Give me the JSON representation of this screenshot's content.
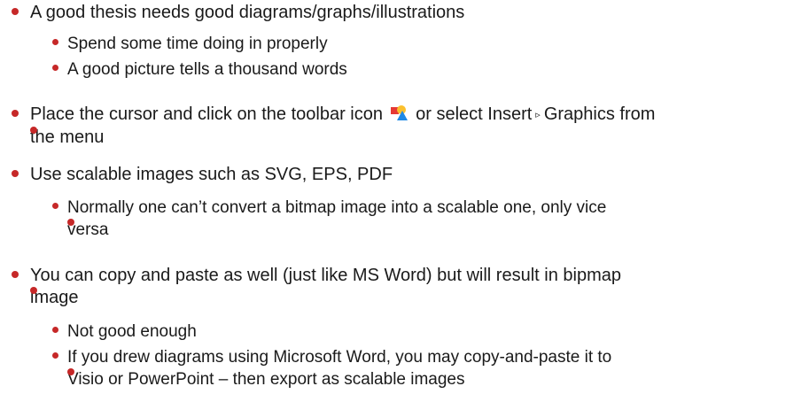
{
  "bullets": [
    {
      "text": "A good thesis needs good diagrams/graphs/illustrations"
    },
    {
      "text": "Spend some time doing in properly"
    },
    {
      "text": "A good picture tells a thousand words"
    },
    {
      "pre": "Place the cursor and click on the toolbar icon",
      "mid": "or select Insert",
      "arrow": "▹",
      "post": "Graphics from",
      "line2": "the menu"
    },
    {
      "text": "Use scalable images such as SVG, EPS, PDF"
    },
    {
      "line1": "Normally one can’t convert a bitmap image into a scalable one, only vice",
      "line2": "versa"
    },
    {
      "line1": "You can copy and paste as well (just like MS Word) but will result in bipmap",
      "line2": "image"
    },
    {
      "text": "Not good enough"
    },
    {
      "line1": "If you drew diagrams using Microsoft Word, you may copy-and-paste it to",
      "line2": "Visio or PowerPoint – then export as scalable images"
    }
  ],
  "icons": {
    "bullet_color": "#c62828",
    "toolbar_icon": "insert-graphics-icon"
  }
}
